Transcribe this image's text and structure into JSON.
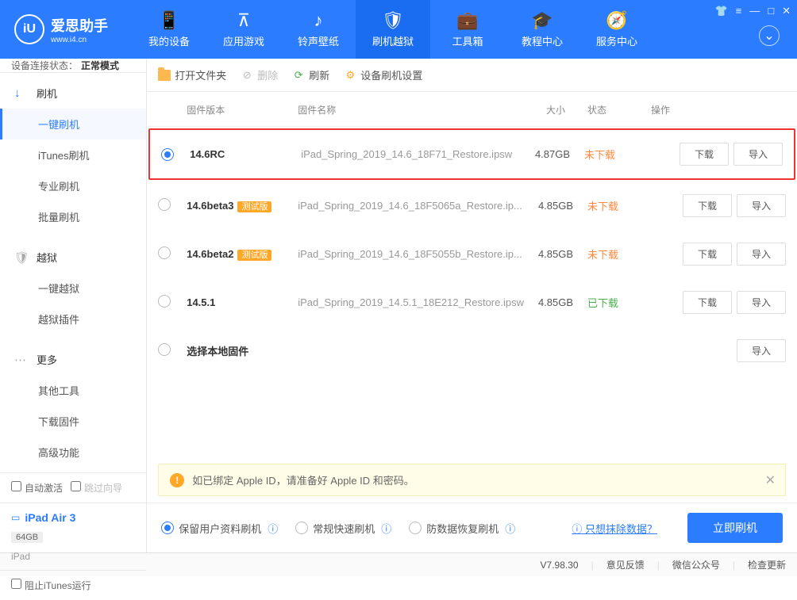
{
  "logo": {
    "text": "爱思助手",
    "url": "www.i4.cn"
  },
  "nav": [
    {
      "label": "我的设备",
      "icon": "📱"
    },
    {
      "label": "应用游戏",
      "icon": "⊼"
    },
    {
      "label": "铃声壁纸",
      "icon": "♪"
    },
    {
      "label": "刷机越狱",
      "icon": "🛡",
      "active": true
    },
    {
      "label": "工具箱",
      "icon": "💼"
    },
    {
      "label": "教程中心",
      "icon": "🎓"
    },
    {
      "label": "服务中心",
      "icon": "🧭"
    }
  ],
  "status": {
    "label": "设备连接状态：",
    "value": "正常模式"
  },
  "sidebar": {
    "sections": [
      {
        "title": "刷机",
        "icon": "↓",
        "color": "#2b7cff",
        "items": [
          "一键刷机",
          "iTunes刷机",
          "专业刷机",
          "批量刷机"
        ],
        "activeIndex": 0
      },
      {
        "title": "越狱",
        "icon": "🛡",
        "color": "#aaa",
        "items": [
          "一键越狱",
          "越狱插件"
        ]
      },
      {
        "title": "更多",
        "icon": "⋯",
        "color": "#aaa",
        "items": [
          "其他工具",
          "下载固件",
          "高级功能"
        ]
      }
    ],
    "bottom": {
      "autoActivate": "自动激活",
      "skipGuide": "跳过向导",
      "device": {
        "name": "iPad Air 3",
        "storage": "64GB",
        "type": "iPad"
      },
      "blockItunes": "阻止iTunes运行"
    }
  },
  "toolbar": {
    "openFolder": "打开文件夹",
    "delete": "删除",
    "refresh": "刷新",
    "settings": "设备刷机设置"
  },
  "table": {
    "headers": {
      "version": "固件版本",
      "name": "固件名称",
      "size": "大小",
      "status": "状态",
      "action": "操作"
    },
    "rows": [
      {
        "selected": true,
        "highlight": true,
        "version": "14.6RC",
        "beta": false,
        "name": "iPad_Spring_2019_14.6_18F71_Restore.ipsw",
        "size": "4.87GB",
        "status": "未下载",
        "statusClass": "orange",
        "actions": [
          "下载",
          "导入"
        ]
      },
      {
        "selected": false,
        "version": "14.6beta3",
        "beta": true,
        "name": "iPad_Spring_2019_14.6_18F5065a_Restore.ip...",
        "size": "4.85GB",
        "status": "未下载",
        "statusClass": "orange",
        "actions": [
          "下载",
          "导入"
        ]
      },
      {
        "selected": false,
        "version": "14.6beta2",
        "beta": true,
        "name": "iPad_Spring_2019_14.6_18F5055b_Restore.ip...",
        "size": "4.85GB",
        "status": "未下载",
        "statusClass": "orange",
        "actions": [
          "下载",
          "导入"
        ]
      },
      {
        "selected": false,
        "version": "14.5.1",
        "beta": false,
        "name": "iPad_Spring_2019_14.5.1_18E212_Restore.ipsw",
        "size": "4.85GB",
        "status": "已下载",
        "statusClass": "green",
        "actions": [
          "下载",
          "导入"
        ]
      },
      {
        "selected": false,
        "version": "选择本地固件",
        "beta": false,
        "name": "",
        "size": "",
        "status": "",
        "statusClass": "",
        "actions": [
          "导入"
        ]
      }
    ],
    "betaLabel": "测试版"
  },
  "infoBar": "如已绑定 Apple ID，请准备好 Apple ID 和密码。",
  "options": {
    "opt1": "保留用户资料刷机",
    "opt2": "常规快速刷机",
    "opt3": "防数据恢复刷机",
    "link": "只想抹除数据？",
    "flash": "立即刷机"
  },
  "footer": {
    "version": "V7.98.30",
    "feedback": "意见反馈",
    "wechat": "微信公众号",
    "update": "检查更新"
  }
}
